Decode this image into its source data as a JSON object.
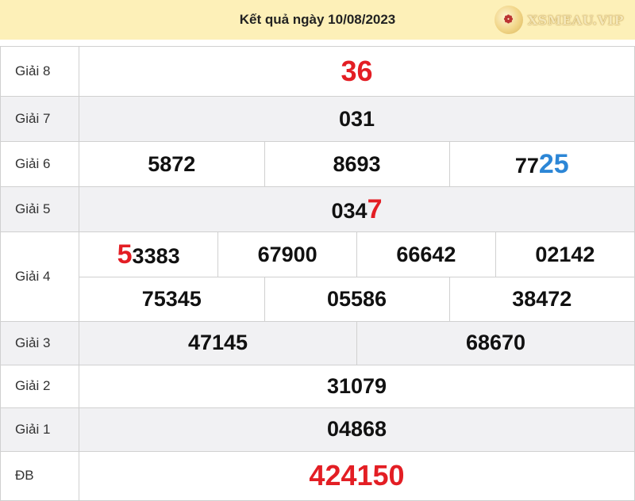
{
  "header": {
    "title": "Kết quả ngày 10/08/2023",
    "logo_text": "XSMEAU.VIP"
  },
  "rows": {
    "g8": {
      "label": "Giải 8",
      "value": "36"
    },
    "g7": {
      "label": "Giải 7",
      "value": "031"
    },
    "g6": {
      "label": "Giải 6",
      "values": [
        "5872",
        "8693"
      ],
      "v3_prefix": "77",
      "v3_suffix": "25"
    },
    "g5": {
      "label": "Giải 5",
      "prefix": "034",
      "suffix": "7"
    },
    "g4": {
      "label": "Giải 4",
      "first_lead": "5",
      "first_rest": "3383",
      "row1": [
        "67900",
        "66642",
        "02142"
      ],
      "row2": [
        "75345",
        "05586",
        "38472"
      ]
    },
    "g3": {
      "label": "Giải 3",
      "values": [
        "47145",
        "68670"
      ]
    },
    "g2": {
      "label": "Giải 2",
      "value": "31079"
    },
    "g1": {
      "label": "Giải 1",
      "value": "04868"
    },
    "db": {
      "label": "ĐB",
      "value": "424150"
    }
  },
  "colors": {
    "header_bg": "#fdf0b8",
    "red": "#e31e24",
    "blue": "#2c86d6",
    "alt_row": "#f1f1f3"
  }
}
